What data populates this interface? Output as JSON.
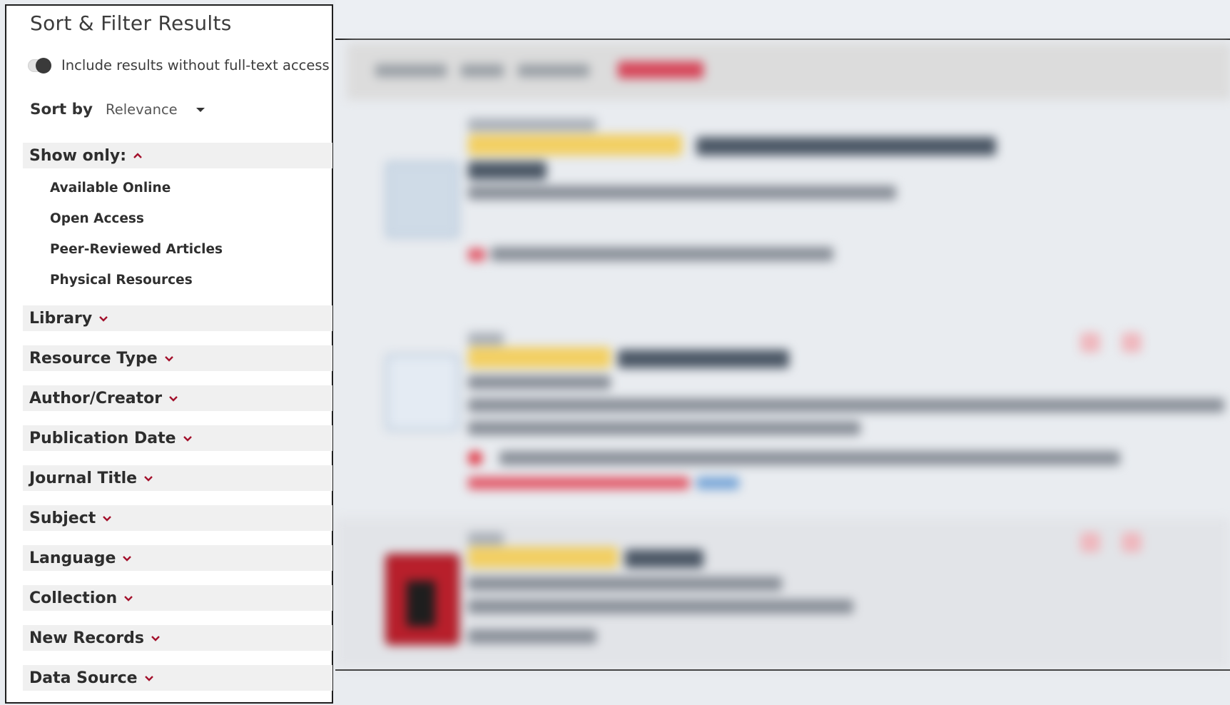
{
  "sidebar": {
    "title": "Sort & Filter Results",
    "toggle_label": "Include results without full-text access",
    "sort_label": "Sort by",
    "sort_value": "Relevance",
    "show_only": {
      "label": "Show only:",
      "options": [
        "Available Online",
        "Open Access",
        "Peer-Reviewed Articles",
        "Physical Resources"
      ]
    },
    "facets": [
      "Library",
      "Resource Type",
      "Author/Creator",
      "Publication Date",
      "Journal Title",
      "Subject",
      "Language",
      "Collection",
      "New Records",
      "Data Source"
    ]
  },
  "colors": {
    "accent": "#a3102b",
    "panel_bg": "#ffffff",
    "facet_bg": "#f0f0f0",
    "highlight": "#f2cf63"
  }
}
